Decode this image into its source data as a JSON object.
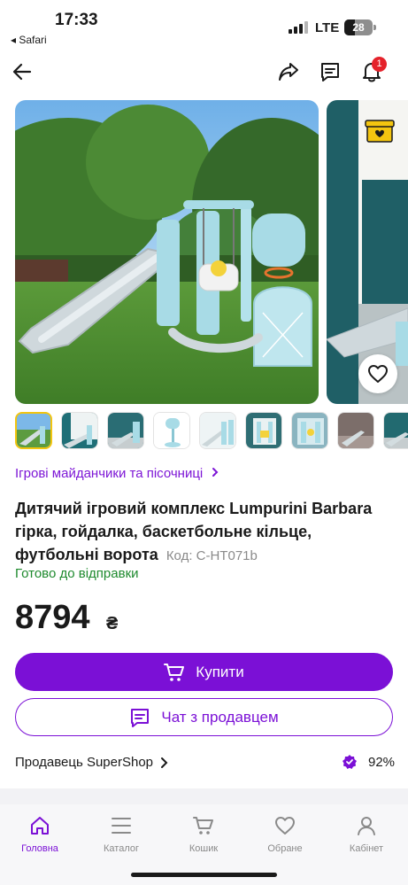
{
  "status_bar": {
    "time": "17:33",
    "back_app": "◂ Safari",
    "network": "LTE",
    "battery": "28"
  },
  "nav": {
    "notifications_count": "1"
  },
  "gallery": {
    "thumbnail_count": 9
  },
  "product": {
    "breadcrumb": "Ігрові майданчики та пісочниці",
    "title": "Дитячий ігровий комплекс Lumpurini Barbara гірка, гойдалка, баскетбольне кільце, футбольні ворота",
    "code": "Код: С-НТ071b",
    "availability": "Готово до відправки",
    "price": "8794",
    "currency": "₴"
  },
  "actions": {
    "buy_label": "Купити",
    "chat_label": "Чат з продавцем"
  },
  "seller": {
    "label": "Продавець SuperShop",
    "rating": "92%"
  },
  "tabbar": {
    "items": [
      {
        "label": "Головна",
        "icon": "home-icon"
      },
      {
        "label": "Каталог",
        "icon": "menu-icon"
      },
      {
        "label": "Кошик",
        "icon": "cart-icon"
      },
      {
        "label": "Обране",
        "icon": "heart-icon"
      },
      {
        "label": "Кабінет",
        "icon": "user-icon"
      }
    ]
  },
  "colors": {
    "accent": "#7b10d6",
    "availability": "#1e8a2e",
    "badge": "#e5222b"
  }
}
